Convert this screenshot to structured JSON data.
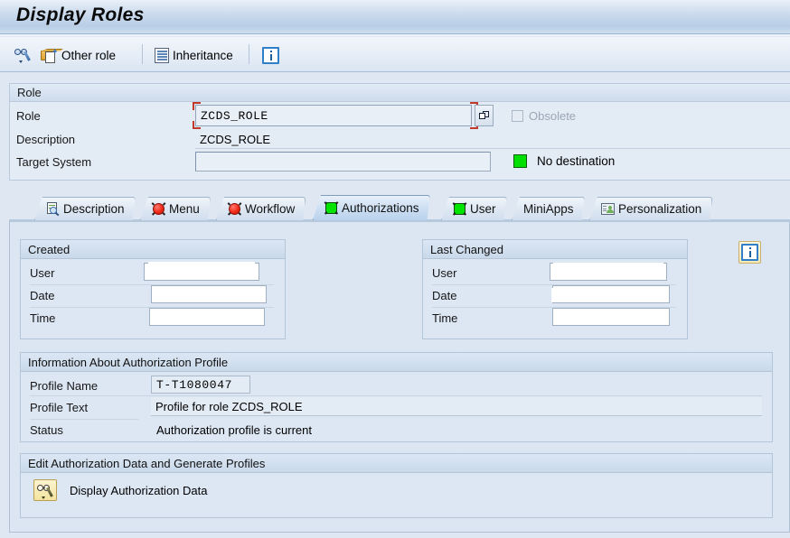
{
  "window": {
    "title": "Display Roles"
  },
  "toolbar": {
    "items": [
      {
        "name": "display-role-icon",
        "label": ""
      },
      {
        "name": "other-role-button",
        "label": "Other role"
      },
      {
        "name": "inheritance-button",
        "label": "Inheritance"
      },
      {
        "name": "info-button",
        "label": ""
      }
    ],
    "other_role_label": "Other role",
    "inheritance_label": "Inheritance"
  },
  "role_group": {
    "header": "Role",
    "role_label": "Role",
    "role_value": "ZCDS_ROLE",
    "description_label": "Description",
    "description_value": "ZCDS_ROLE",
    "target_system_label": "Target System",
    "target_system_value": "",
    "obsolete_label": "Obsolete",
    "obsolete_checked": false,
    "destination_status": "No destination",
    "destination_color": "#00e000"
  },
  "tabs": [
    {
      "label": "Description",
      "icon": "document-search-icon",
      "active": false
    },
    {
      "label": "Menu",
      "icon": "red-sphere-icon",
      "active": false
    },
    {
      "label": "Workflow",
      "icon": "red-sphere-icon",
      "active": false
    },
    {
      "label": "Authorizations",
      "icon": "green-square-icon",
      "active": true
    },
    {
      "label": "User",
      "icon": "green-square-icon",
      "active": false
    },
    {
      "label": "MiniApps",
      "icon": "none",
      "active": false
    },
    {
      "label": "Personalization",
      "icon": "person-card-icon",
      "active": false
    }
  ],
  "created_panel": {
    "header": "Created",
    "rows": [
      {
        "label": "User",
        "value": ""
      },
      {
        "label": "Date",
        "value": ""
      },
      {
        "label": "Time",
        "value": ""
      }
    ]
  },
  "last_changed_panel": {
    "header": "Last Changed",
    "rows": [
      {
        "label": "User",
        "value": ""
      },
      {
        "label": "Date",
        "value": ""
      },
      {
        "label": "Time",
        "value": ""
      }
    ]
  },
  "profile_panel": {
    "header": "Information About Authorization Profile",
    "profile_name_label": "Profile Name",
    "profile_name_value": "T-T1080047",
    "profile_text_label": "Profile Text",
    "profile_text_value": "Profile for role ZCDS_ROLE",
    "status_label": "Status",
    "status_value": "Authorization profile is current"
  },
  "edit_panel": {
    "header": "Edit Authorization Data and Generate Profiles",
    "button_label": "Display Authorization Data",
    "button_icon": "glasses-pen-icon"
  },
  "colors": {
    "accent": "#00e000",
    "focus_outline": "#c0392b",
    "panel_bg": "#dbe6f2",
    "title_bg": "#c3d5ea"
  }
}
